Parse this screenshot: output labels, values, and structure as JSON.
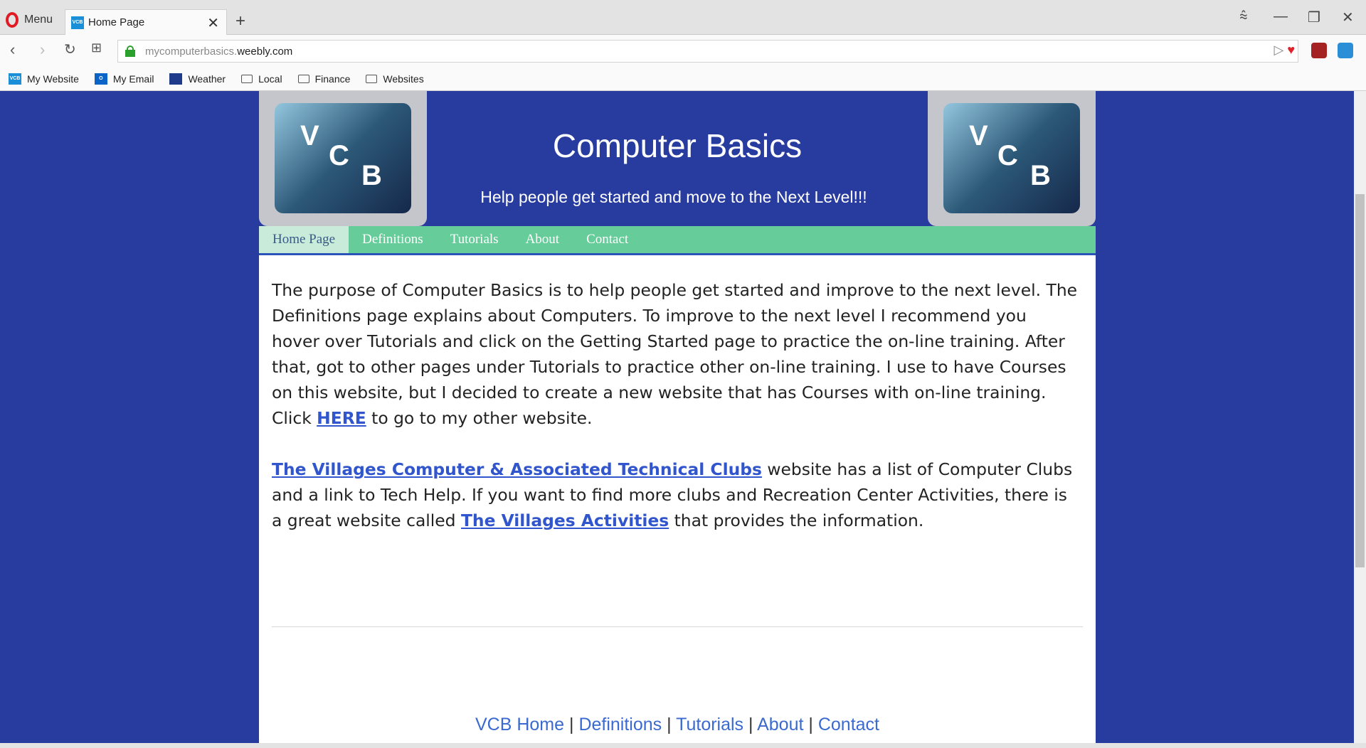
{
  "browser": {
    "menu_label": "Menu",
    "tab_title": "Home Page",
    "tab_favicon": "VCB",
    "url_subdomain": "mycomputerbasics.",
    "url_domain": "weebly.com",
    "bookmarks": [
      {
        "label": "My Website",
        "icon": "vcb-favicon"
      },
      {
        "label": "My Email",
        "icon": "outlook-icon"
      },
      {
        "label": "Weather",
        "icon": "weather-icon"
      },
      {
        "label": "Local",
        "icon": "folder-icon"
      },
      {
        "label": "Finance",
        "icon": "folder-icon"
      },
      {
        "label": "Websites",
        "icon": "folder-icon"
      }
    ]
  },
  "header": {
    "logo_letters": [
      "V",
      "C",
      "B"
    ],
    "title": "Computer Basics",
    "tagline": "Help people get started and move to the Next Level!!!"
  },
  "nav": {
    "items": [
      "Home Page",
      "Definitions",
      "Tutorials",
      "About",
      "Contact"
    ],
    "active": "Home Page"
  },
  "main": {
    "p1_text": "The purpose of Computer Basics is to help people get started and improve to the next level.  The Definitions page explains about Computers.  To improve to the next level I recommend you hover over Tutorials and click on the Getting Started page to practice the on-line training.  After that, got to other pages under Tutorials to practice other on-line training.  I use to have Courses on this website, but I decided to create a new website that has Courses with on-line training.  Click ",
    "p1_link": "HERE",
    "p1_after": " to go to my other website.",
    "p2_link1": "The Villages Computer & Associated Technical Clubs",
    "p2_mid": " website has a list of Computer Clubs and a link to Tech Help.  If you want to find more clubs and Recreation Center Activities, there is a great website called ",
    "p2_link2": "The Villages Activities",
    "p2_after": " that provides the information."
  },
  "footer": {
    "links": [
      "VCB Home",
      "Definitions",
      "Tutorials",
      "About",
      "Contact"
    ],
    "separator": "|"
  },
  "colors": {
    "page_bg": "#283c9f",
    "nav_bg": "#66cc99",
    "link": "#3055cc"
  }
}
